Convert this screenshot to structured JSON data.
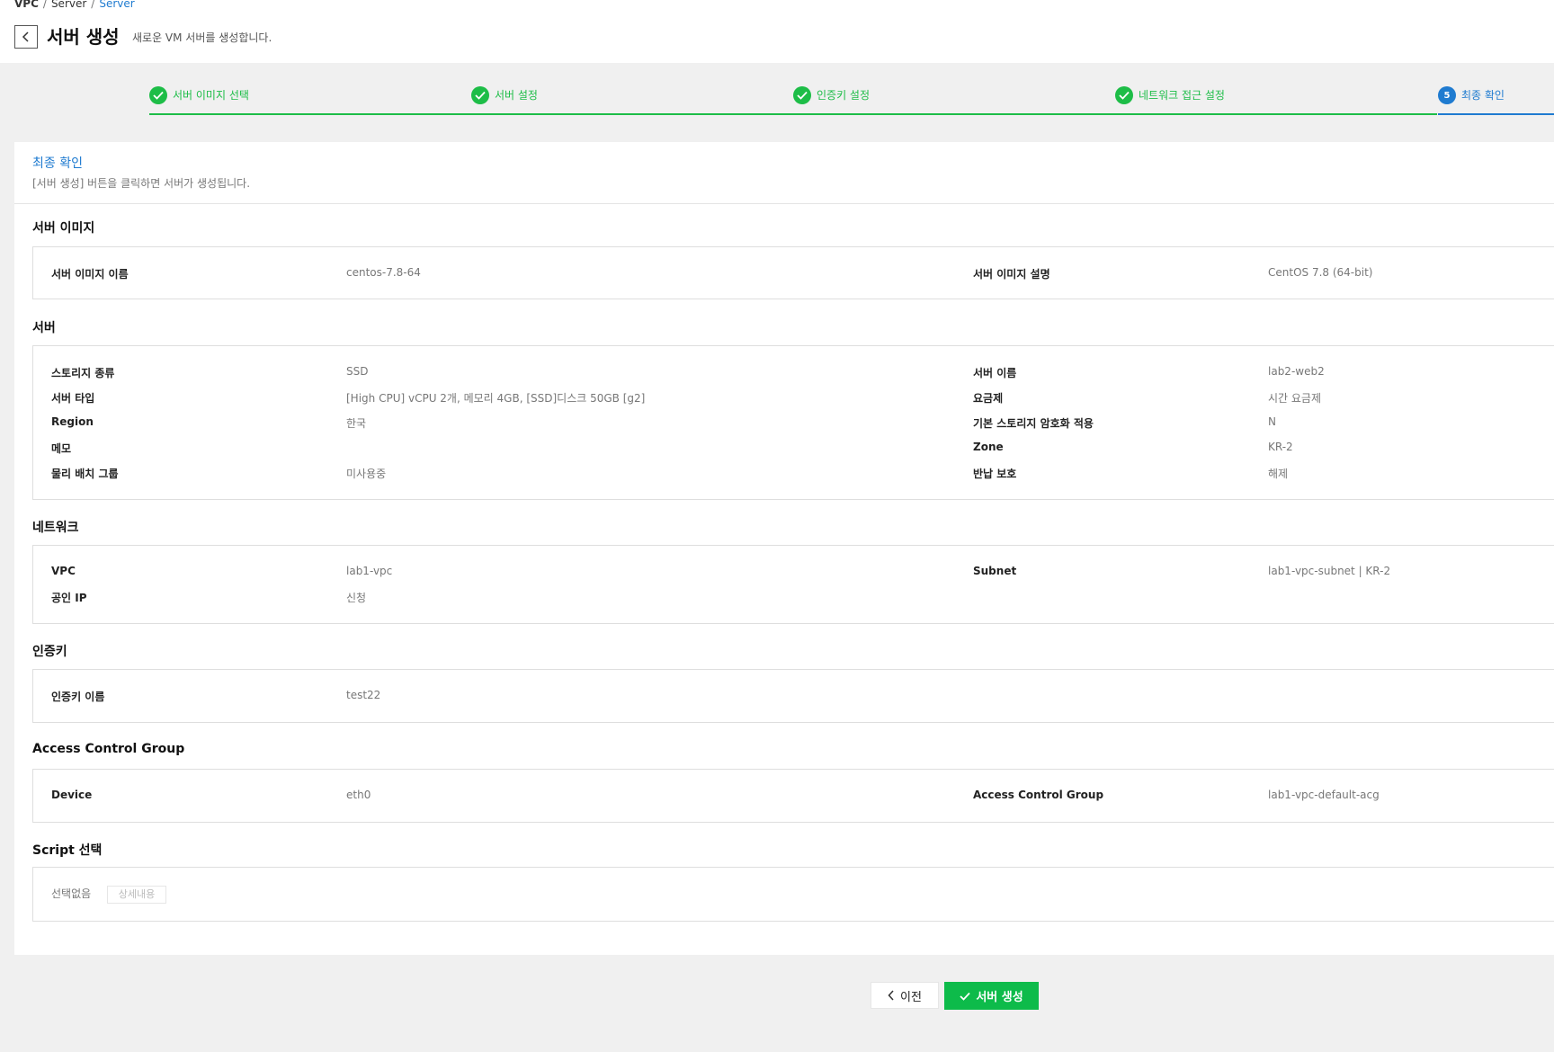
{
  "breadcrumb": [
    "VPC",
    "Server",
    "Server"
  ],
  "header": {
    "title": "서버 생성",
    "subtitle": "새로운 VM 서버를 생성합니다."
  },
  "steps": [
    {
      "label": "서버 이미지 선택",
      "status": "done"
    },
    {
      "label": "서버 설정",
      "status": "done"
    },
    {
      "label": "인증키 설정",
      "status": "done"
    },
    {
      "label": "네트워크 접근 설정",
      "status": "done"
    },
    {
      "label": "최종 확인",
      "status": "active",
      "number": "5"
    }
  ],
  "summary": {
    "title": "최종 확인",
    "description": "[서버 생성] 버튼을 클릭하면 서버가 생성됩니다."
  },
  "sections": {
    "image": {
      "title": "서버 이미지",
      "rows": [
        {
          "l1": "서버 이미지 이름",
          "v1": "centos-7.8-64",
          "l2": "서버 이미지 설명",
          "v2": "CentOS 7.8 (64-bit)"
        }
      ]
    },
    "server": {
      "title": "서버",
      "rows": [
        {
          "l1": "스토리지 종류",
          "v1": "SSD",
          "l2": "서버 이름",
          "v2": "lab2-web2"
        },
        {
          "l1": "서버 타입",
          "v1": "[High CPU] vCPU 2개, 메모리 4GB, [SSD]디스크 50GB [g2]",
          "l2": "요금제",
          "v2": "시간 요금제"
        },
        {
          "l1": "Region",
          "v1": "한국",
          "l2": "기본 스토리지 암호화 적용",
          "v2": "N"
        },
        {
          "l1": "메모",
          "v1": "",
          "l2": "Zone",
          "v2": "KR-2"
        },
        {
          "l1": "물리 배치 그룹",
          "v1": "미사용중",
          "l2": "반납 보호",
          "v2": "해제"
        }
      ]
    },
    "network": {
      "title": "네트워크",
      "rows": [
        {
          "l1": "VPC",
          "v1": "lab1-vpc",
          "l2": "Subnet",
          "v2": "lab1-vpc-subnet | KR-2"
        },
        {
          "l1": "공인 IP",
          "v1": "신청",
          "l2": "",
          "v2": ""
        }
      ]
    },
    "authkey": {
      "title": "인증키",
      "rows": [
        {
          "l1": "인증키 이름",
          "v1": "test22",
          "l2": "",
          "v2": ""
        }
      ]
    },
    "acg": {
      "title": "Access Control Group",
      "rows": [
        {
          "l1": "Device",
          "v1": "eth0",
          "l2": "Access Control Group",
          "v2": "lab1-vpc-default-acg"
        }
      ]
    },
    "script": {
      "title": "Script 선택",
      "value": "선택없음",
      "detail_label": "상세내용"
    }
  },
  "actions": {
    "prev_label": "이전",
    "create_label": "서버 생성"
  },
  "colors": {
    "success": "#1dbd47",
    "accent": "#1f7bd0",
    "create_button": "#0dbb4a"
  }
}
